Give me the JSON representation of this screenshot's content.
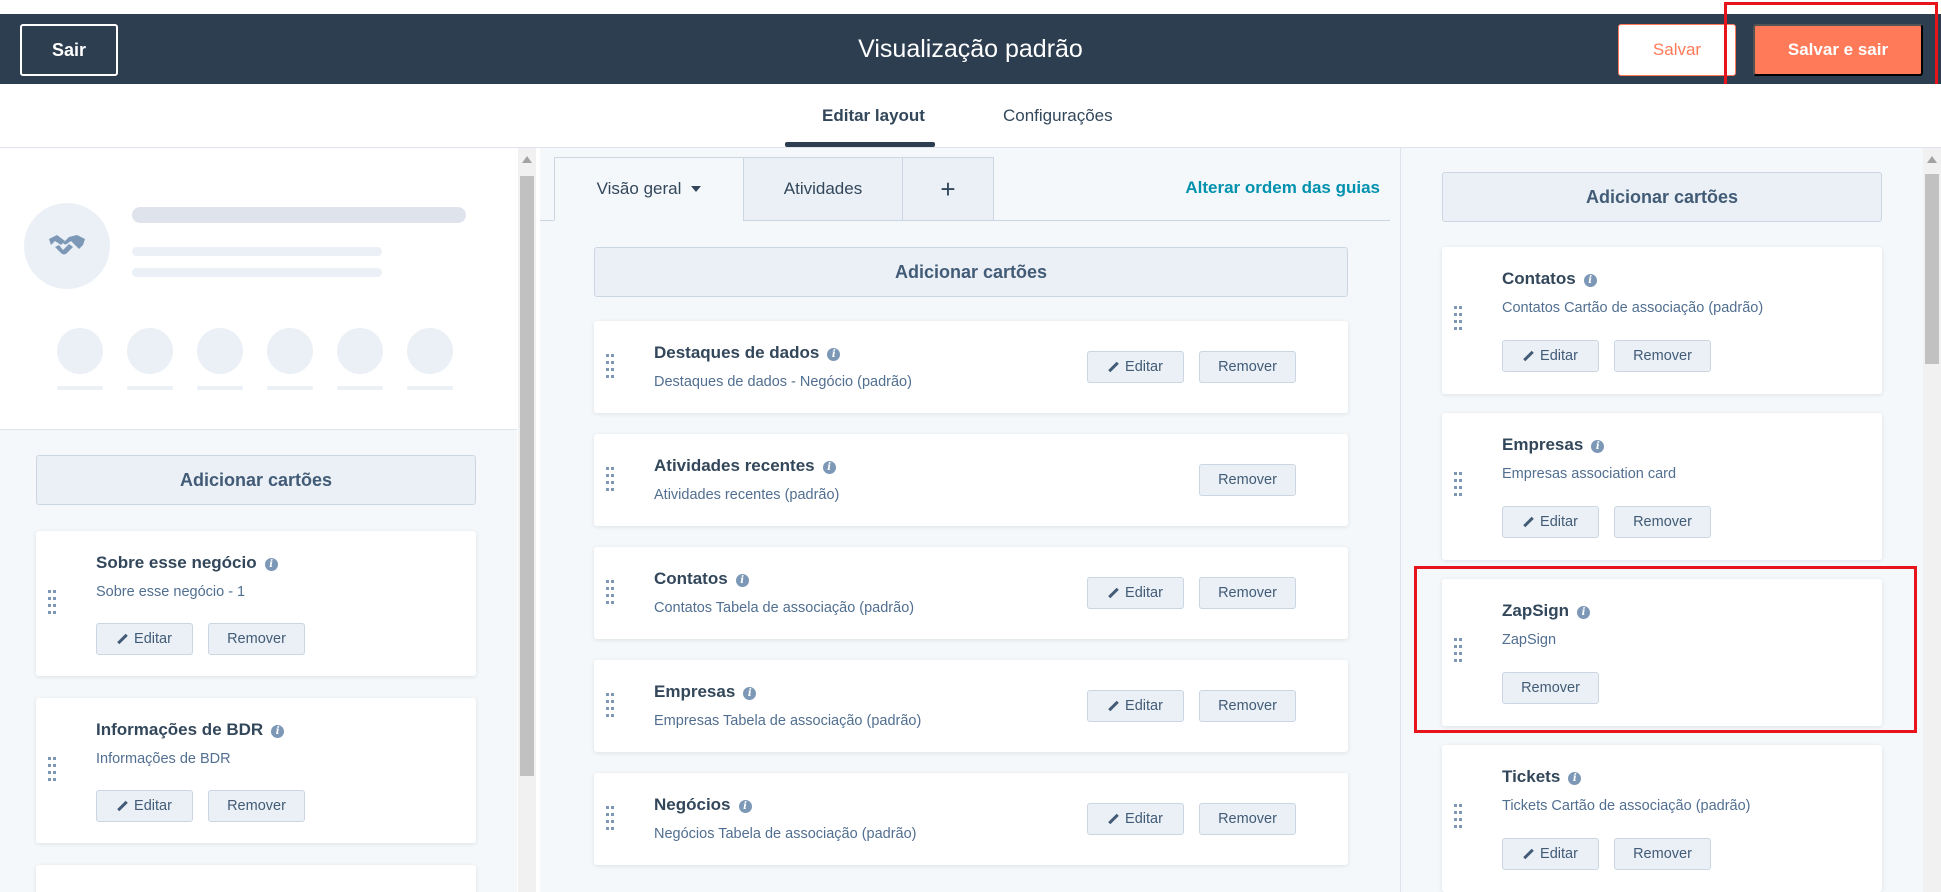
{
  "header": {
    "exit_label": "Sair",
    "title": "Visualização padrão",
    "save_label": "Salvar",
    "save_exit_label": "Salvar e sair"
  },
  "main_tabs": [
    {
      "label": "Editar layout",
      "active": true
    },
    {
      "label": "Configurações",
      "active": false
    }
  ],
  "left": {
    "add_cards_label": "Adicionar cartões",
    "cards": [
      {
        "title": "Sobre esse negócio",
        "subtitle": "Sobre esse negócio - 1",
        "edit": "Editar",
        "remove": "Remover"
      },
      {
        "title": "Informações de BDR",
        "subtitle": "Informações de BDR",
        "edit": "Editar",
        "remove": "Remover"
      }
    ]
  },
  "middle": {
    "tabs": [
      {
        "label": "Visão geral",
        "active": true
      },
      {
        "label": "Atividades",
        "active": false
      },
      {
        "label": "+",
        "active": false
      }
    ],
    "reorder_label": "Alterar ordem das guias",
    "add_cards_label": "Adicionar cartões",
    "cards": [
      {
        "title": "Destaques de dados",
        "subtitle": "Destaques de dados - Negócio (padrão)",
        "edit": "Editar",
        "remove": "Remover"
      },
      {
        "title": "Atividades recentes",
        "subtitle": "Atividades recentes (padrão)",
        "remove": "Remover"
      },
      {
        "title": "Contatos",
        "subtitle": "Contatos Tabela de associação (padrão)",
        "edit": "Editar",
        "remove": "Remover"
      },
      {
        "title": "Empresas",
        "subtitle": "Empresas Tabela de associação (padrão)",
        "edit": "Editar",
        "remove": "Remover"
      },
      {
        "title": "Negócios",
        "subtitle": "Negócios Tabela de associação (padrão)",
        "edit": "Editar",
        "remove": "Remover"
      }
    ]
  },
  "right": {
    "add_cards_label": "Adicionar cartões",
    "cards": [
      {
        "title": "Contatos",
        "subtitle": "Contatos Cartão de associação (padrão)",
        "edit": "Editar",
        "remove": "Remover"
      },
      {
        "title": "Empresas",
        "subtitle": "Empresas association card",
        "edit": "Editar",
        "remove": "Remover"
      },
      {
        "title": "ZapSign",
        "subtitle": "ZapSign",
        "remove": "Remover"
      },
      {
        "title": "Tickets",
        "subtitle": "Tickets Cartão de associação (padrão)",
        "edit": "Editar",
        "remove": "Remover"
      }
    ]
  },
  "colors": {
    "header_bg": "#2d3e50",
    "accent": "#ff7a59",
    "link": "#0091ae",
    "highlight": "#e8141c"
  }
}
